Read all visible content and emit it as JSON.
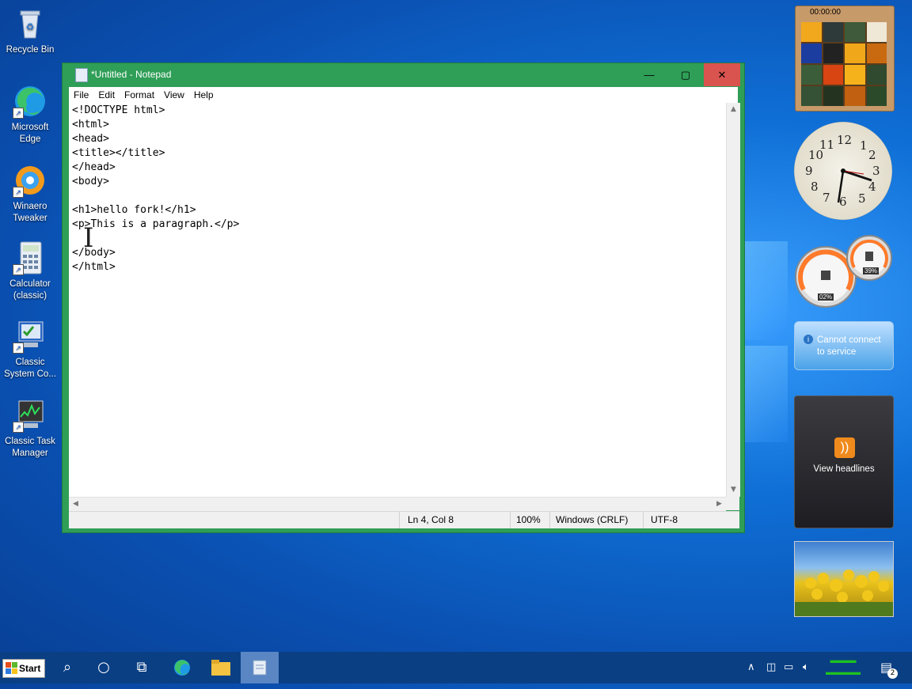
{
  "desktop": {
    "icons": [
      {
        "label": "Recycle Bin"
      },
      {
        "label": "Microsoft Edge"
      },
      {
        "label": "Winaero Tweaker"
      },
      {
        "label": "Calculator (classic)"
      },
      {
        "label": "Classic System Co..."
      },
      {
        "label": "Classic Task Manager"
      }
    ]
  },
  "notepad": {
    "title": "*Untitled - Notepad",
    "menu": [
      "File",
      "Edit",
      "Format",
      "View",
      "Help"
    ],
    "content": "<!DOCTYPE html>\n<html>\n<head>\n<title></title>\n</head>\n<body>\n\n<h1>hello fork!</h1>\n<p>This is a paragraph.</p>\n\n</body>\n</html>",
    "status": {
      "position": "Ln 4, Col 8",
      "zoom": "100%",
      "line_ending": "Windows (CRLF)",
      "encoding": "UTF-8"
    }
  },
  "gadgets": {
    "puzzle_timer": "00:00:00",
    "clock_numbers": [
      "12",
      "1",
      "2",
      "3",
      "4",
      "5",
      "6",
      "7",
      "8",
      "9",
      "10",
      "11"
    ],
    "cpu_meter": {
      "cpu": "02%",
      "memory": "39%"
    },
    "weather_message": "Cannot connect to service",
    "feed_label": "View headlines"
  },
  "taskbar": {
    "start_label": "Start",
    "notification_count": "2"
  },
  "colors": {
    "notepad_frame": "#2f9e57",
    "close_button": "#d9534f",
    "taskbar": "#0a3f84"
  }
}
